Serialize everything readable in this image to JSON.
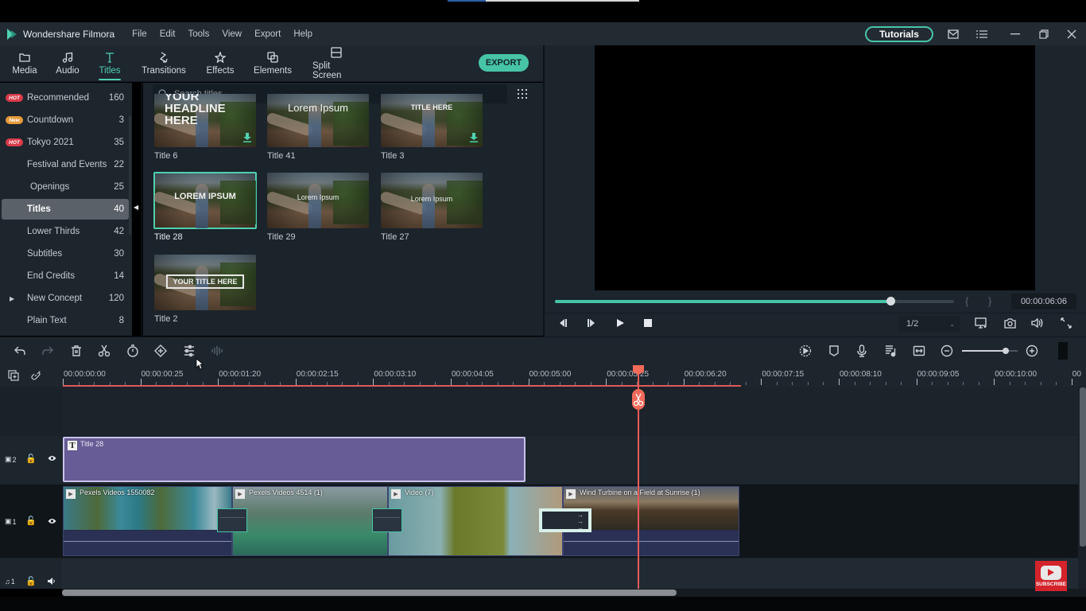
{
  "app": {
    "title": "Wondershare Filmora",
    "menu": [
      "File",
      "Edit",
      "Tools",
      "View",
      "Export",
      "Help"
    ],
    "tutorials_label": "Tutorials",
    "window_icons": [
      "mail-icon",
      "list-menu-icon",
      "minimize-icon",
      "restore-icon",
      "close-icon"
    ]
  },
  "media_tabs": [
    {
      "label": "Media",
      "icon": "folder-icon",
      "active": false
    },
    {
      "label": "Audio",
      "icon": "music-note-icon",
      "active": false
    },
    {
      "label": "Titles",
      "icon": "text-t-icon",
      "active": true
    },
    {
      "label": "Transitions",
      "icon": "transition-icon",
      "active": false
    },
    {
      "label": "Effects",
      "icon": "effects-sparkle-icon",
      "active": false
    },
    {
      "label": "Elements",
      "icon": "elements-icon",
      "active": false
    },
    {
      "label": "Split Screen",
      "icon": "split-screen-icon",
      "active": false
    }
  ],
  "export_label": "EXPORT",
  "categories": [
    {
      "label": "Recommended",
      "count": "160",
      "badge": "HOT"
    },
    {
      "label": "Countdown",
      "count": "3",
      "badge": "New"
    },
    {
      "label": "Tokyo 2021",
      "count": "35",
      "badge": "HOT"
    },
    {
      "label": "Festival and Events",
      "count": "22",
      "badge": ""
    },
    {
      "label": "Openings",
      "count": "25",
      "badge": ""
    },
    {
      "label": "Titles",
      "count": "40",
      "badge": "",
      "active": true
    },
    {
      "label": "Lower Thirds",
      "count": "42",
      "badge": ""
    },
    {
      "label": "Subtitles",
      "count": "30",
      "badge": ""
    },
    {
      "label": "End Credits",
      "count": "14",
      "badge": ""
    },
    {
      "label": "New Concept",
      "count": "120",
      "badge": "",
      "expandable": true
    },
    {
      "label": "Plain Text",
      "count": "8",
      "badge": ""
    }
  ],
  "search": {
    "placeholder": "Search titles",
    "value": ""
  },
  "titles": [
    {
      "label": "Title 6",
      "overlay": "YOUR HEADLINE HERE",
      "download": true,
      "selected": false
    },
    {
      "label": "Title 41",
      "overlay": "Lorem Ipsum",
      "download": false,
      "selected": false
    },
    {
      "label": "Title 3",
      "overlay": "TITLE HERE",
      "download": true,
      "selected": false
    },
    {
      "label": "Title 28",
      "overlay": "LOREM IPSUM",
      "download": false,
      "selected": true
    },
    {
      "label": "Title 29",
      "overlay": "Lorem Ipsum",
      "download": false,
      "selected": false
    },
    {
      "label": "Title 27",
      "overlay": "Lorem Ipsum",
      "download": false,
      "selected": false
    },
    {
      "label": "Title 2",
      "overlay": "YOUR TITLE HERE",
      "download": false,
      "selected": false
    }
  ],
  "preview": {
    "timecode": "00:00:06:06",
    "progress_fraction": 0.84,
    "quality": "1/2",
    "mark_in": "{",
    "mark_out": "}"
  },
  "timeline": {
    "ruler_labels": [
      "00:00:00:00",
      "00:00:00:25",
      "00:00:01:20",
      "00:00:02:15",
      "00:00:03:10",
      "00:00:04:05",
      "00:00:05:00",
      "00:00:05:25",
      "00:00:06:20",
      "00:00:07:15",
      "00:00:08:10",
      "00:00:09:05",
      "00:00:10:00",
      "00"
    ],
    "zoom_fraction": 0.78,
    "tracks": [
      {
        "id": "V2",
        "label": "2",
        "type": "video"
      },
      {
        "id": "V1",
        "label": "1",
        "type": "video"
      },
      {
        "id": "A1",
        "label": "1",
        "type": "audio"
      }
    ],
    "title_clip": {
      "name": "Title 28"
    },
    "video_clips": [
      {
        "name": "Pexels Videos 1550082"
      },
      {
        "name": "Pexels Videos 4514 (1)"
      },
      {
        "name": "Video (7)"
      },
      {
        "name": "Wind Turbine on a Field at Sunrise (1)"
      }
    ],
    "horizontal_scroll_fraction": 0.6
  },
  "overlay": {
    "subscribe_label": "SUBSCRIBE"
  },
  "colors": {
    "accent": "#47c4a6",
    "playhead": "#e85a5a",
    "title_clip": "#675c95",
    "hot_badge": "#d93a4a",
    "new_badge": "#e69a3a"
  }
}
